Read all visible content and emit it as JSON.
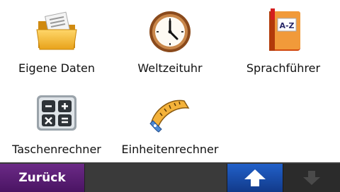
{
  "tiles": [
    {
      "label": "Eigene Daten",
      "icon": "folder-icon"
    },
    {
      "label": "Weltzeituhr",
      "icon": "clock-icon"
    },
    {
      "label": "Sprachführer",
      "icon": "phrasebook-icon"
    },
    {
      "label": "Taschenrechner",
      "icon": "calculator-icon"
    },
    {
      "label": "Einheitenrechner",
      "icon": "measuring-tape-icon"
    }
  ],
  "toolbar": {
    "back_label": "Zurück",
    "up_icon": "arrow-up-icon",
    "down_icon": "arrow-down-icon"
  },
  "colors": {
    "back_button": "#5a1d76",
    "up_button": "#1a4fb0",
    "toolbar_bg": "#3a3a3a"
  }
}
